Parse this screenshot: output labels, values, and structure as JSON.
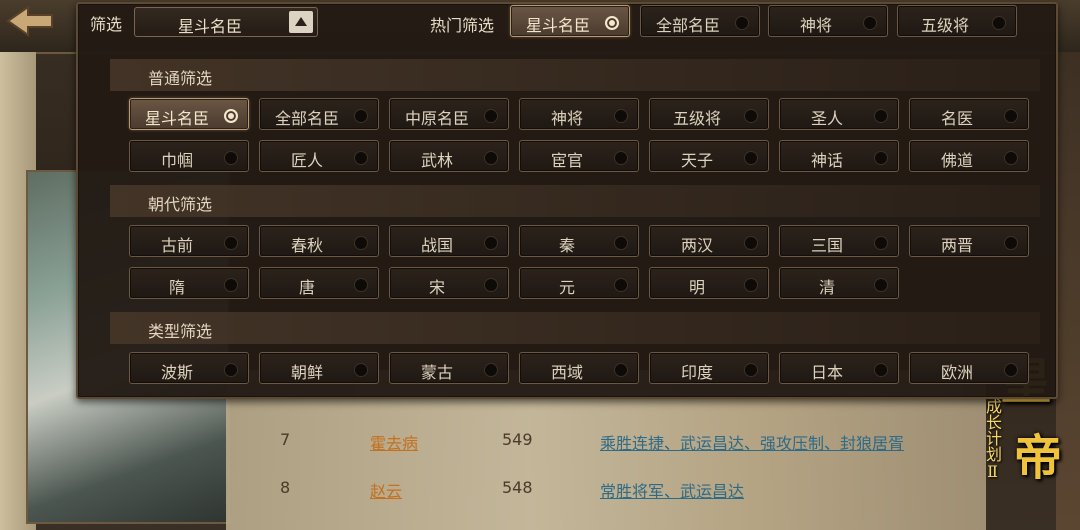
{
  "background": {
    "rows": [
      {
        "rank": "7",
        "name": "霍去病",
        "score": "549",
        "skills": "乘胜连捷、武运昌达、强攻压制、封狼居胥"
      },
      {
        "rank": "8",
        "name": "赵云",
        "score": "548",
        "skills": "常胜将军、武运昌达"
      }
    ],
    "logo": {
      "big1": "皇",
      "big2": "帝",
      "sub": "成长计划Ⅱ"
    }
  },
  "filter": {
    "label": "筛选",
    "dropdown_value": "星斗名臣",
    "hot_label": "热门筛选",
    "hot": [
      {
        "label": "星斗名臣",
        "selected": true
      },
      {
        "label": "全部名臣",
        "selected": false
      },
      {
        "label": "神将",
        "selected": false
      },
      {
        "label": "五级将",
        "selected": false
      }
    ]
  },
  "sections": {
    "normal": {
      "title": "普通筛选",
      "items": [
        "星斗名臣",
        "全部名臣",
        "中原名臣",
        "神将",
        "五级将",
        "圣人",
        "名医",
        "巾帼",
        "匠人",
        "武林",
        "宦官",
        "天子",
        "神话",
        "佛道"
      ],
      "selected_index": 0
    },
    "dynasty": {
      "title": "朝代筛选",
      "items": [
        "古前",
        "春秋",
        "战国",
        "秦",
        "两汉",
        "三国",
        "两晋",
        "隋",
        "唐",
        "宋",
        "元",
        "明",
        "清"
      ]
    },
    "type": {
      "title": "类型筛选",
      "items": [
        "波斯",
        "朝鲜",
        "蒙古",
        "西域",
        "印度",
        "日本",
        "欧洲"
      ]
    }
  },
  "colors": {
    "accent": "#b79a74",
    "name_link": "#c4701e",
    "skill_link": "#2f6a86",
    "logo_gold": "#f0c33c"
  }
}
